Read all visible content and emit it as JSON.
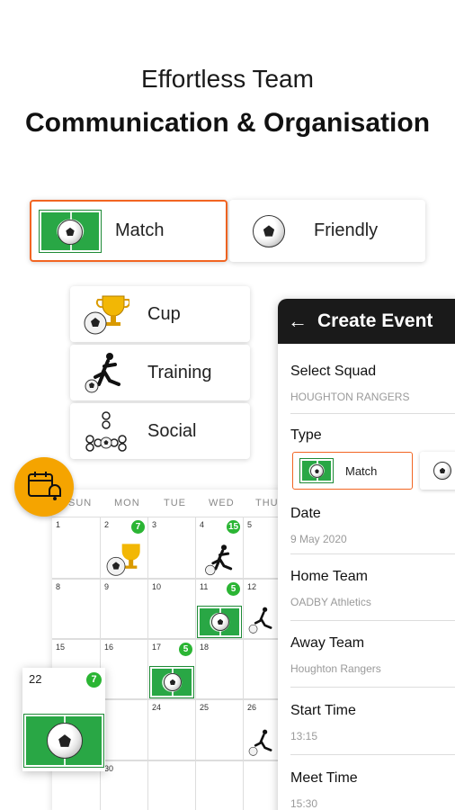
{
  "headline": {
    "line1": "Effortless Team",
    "line2": "Communication & Organisation"
  },
  "event_types": {
    "match": {
      "label": "Match",
      "icon": "football-pitch-icon",
      "selected": true
    },
    "friendly": {
      "label": "Friendly",
      "icon": "football-icon"
    }
  },
  "categories": [
    {
      "label": "Cup",
      "icon": "trophy-icon"
    },
    {
      "label": "Training",
      "icon": "player-kicking-icon"
    },
    {
      "label": "Social",
      "icon": "team-group-icon"
    }
  ],
  "create_event": {
    "title": "Create Event",
    "back_icon": "back-arrow-icon",
    "select_squad_label": "Select Squad",
    "select_squad_value": "HOUGHTON RANGERS",
    "type_label": "Type",
    "type_selected": "Match",
    "date_label": "Date",
    "date_value": "9 May 2020",
    "home_team_label": "Home Team",
    "home_team_value": "OADBY Athletics",
    "away_team_label": "Away Team",
    "away_team_value": "Houghton Rangers",
    "start_time_label": "Start Time",
    "start_time_value": "13:15",
    "meet_time_label": "Meet Time",
    "meet_time_value": "15:30"
  },
  "calendar": {
    "day_names": [
      "SUN",
      "MON",
      "TUE",
      "WED",
      "THU"
    ],
    "dates": {
      "d1": "1",
      "d2": "2",
      "d3": "3",
      "d4": "4",
      "d5": "5",
      "d8": "8",
      "d9": "9",
      "d10": "10",
      "d11": "11",
      "d12": "12",
      "d15": "15",
      "d16": "16",
      "d17": "17",
      "d18": "18",
      "d24": "24",
      "d25": "25",
      "d26": "26",
      "d30": "30"
    },
    "badges": {
      "b2": "7",
      "b4": "15",
      "b11": "5",
      "b17": "5"
    },
    "zoom_date": "22",
    "zoom_badge": "7"
  },
  "colors": {
    "accent": "#f26522",
    "header_dark": "#1a1a1a",
    "pitch_green": "#29a745",
    "badge_green": "#2bb534",
    "alarm_orange": "#f5a400"
  },
  "icons": {
    "alarm": "calendar-alarm-icon"
  }
}
